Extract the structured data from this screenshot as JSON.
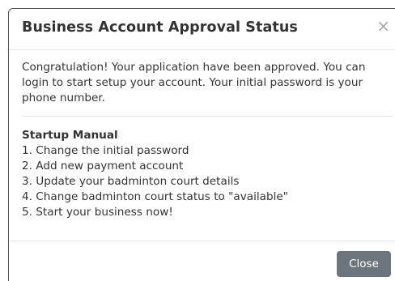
{
  "modal": {
    "title": "Business Account Approval Status",
    "close_symbol": "×",
    "intro": "Congratulation! Your application have been approved. You can login to start setup your account. Your initial password is your phone number.",
    "manual_title": "Startup Manual",
    "steps": [
      "1. Change the initial password",
      "2. Add new payment account",
      "3. Update your badminton court details",
      "4. Change badminton court status to \"available\"",
      "5. Start your business now!"
    ],
    "close_button_label": "Close"
  },
  "colors": {
    "text": "#333333",
    "button_bg": "#6c757d",
    "button_text": "#ffffff",
    "divider": "#e5e5e5",
    "close_icon": "#a8a8a8"
  },
  "icons": {
    "close": "close-icon"
  }
}
